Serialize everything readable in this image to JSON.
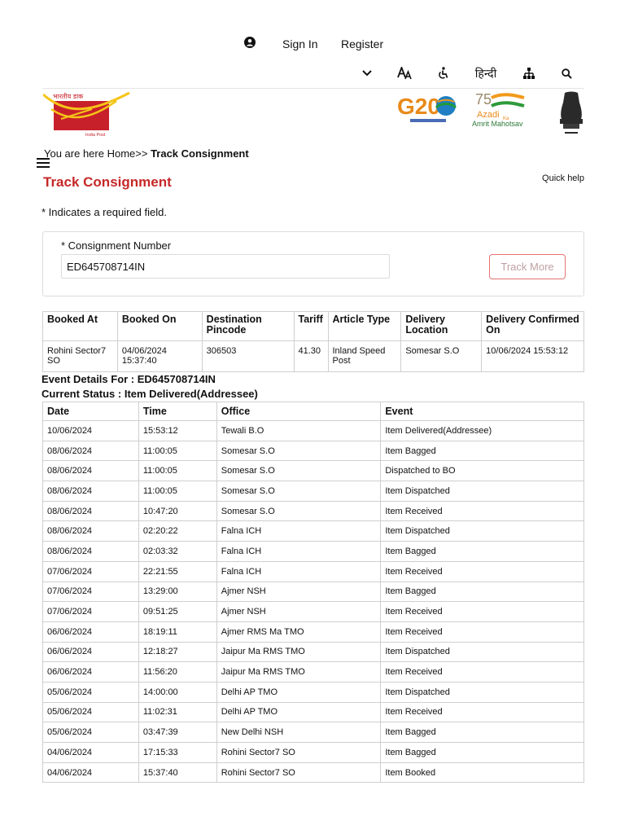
{
  "header": {
    "sign_in": "Sign In",
    "register": "Register",
    "hindi": "हिन्दी",
    "icons": [
      "user-circle-icon",
      "chevron-down-icon",
      "font-size-icon",
      "accessibility-icon",
      "sitemap-icon",
      "search-icon"
    ]
  },
  "logos": {
    "india_post_hindi": "भारतीय डाक",
    "india_post_english": "India Post",
    "g20": "G20",
    "azadi_line1": "Azadi",
    "azadi_ka": "Ka",
    "azadi_line2": "Amrit Mahotsav"
  },
  "breadcrumb": {
    "prefix": "You are here Home>> ",
    "current": "Track Consignment"
  },
  "page": {
    "title": "Track Consignment",
    "quick_help": "Quick help",
    "required_note": "* Indicates a required field."
  },
  "form": {
    "label": "* Consignment Number",
    "value": "ED645708714IN",
    "track_more": "Track More"
  },
  "summary": {
    "headers": [
      "Booked At",
      "Booked On",
      "Destination Pincode",
      "Tariff",
      "Article Type",
      "Delivery Location",
      "Delivery Confirmed On"
    ],
    "row": [
      "Rohini Sector7 SO",
      "04/06/2024 15:37:40",
      "306503",
      "41.30",
      "Inland Speed Post",
      "Somesar S.O",
      "10/06/2024 15:53:12"
    ]
  },
  "event_for": "Event Details For : ED645708714IN",
  "current_status": "Current Status : Item Delivered(Addressee)",
  "events": {
    "headers": [
      "Date",
      "Time",
      "Office",
      "Event"
    ],
    "rows": [
      [
        "10/06/2024",
        "15:53:12",
        "Tewali B.O",
        "Item Delivered(Addressee)"
      ],
      [
        "08/06/2024",
        "11:00:05",
        "Somesar S.O",
        "Item Bagged"
      ],
      [
        "08/06/2024",
        "11:00:05",
        "Somesar S.O",
        "Dispatched to BO"
      ],
      [
        "08/06/2024",
        "11:00:05",
        "Somesar S.O",
        "Item Dispatched"
      ],
      [
        "08/06/2024",
        "10:47:20",
        "Somesar S.O",
        "Item Received"
      ],
      [
        "08/06/2024",
        "02:20:22",
        "Falna ICH",
        "Item Dispatched"
      ],
      [
        "08/06/2024",
        "02:03:32",
        "Falna ICH",
        "Item Bagged"
      ],
      [
        "07/06/2024",
        "22:21:55",
        "Falna ICH",
        "Item Received"
      ],
      [
        "07/06/2024",
        "13:29:00",
        "Ajmer NSH",
        "Item Bagged"
      ],
      [
        "07/06/2024",
        "09:51:25",
        "Ajmer NSH",
        "Item Received"
      ],
      [
        "06/06/2024",
        "18:19:11",
        "Ajmer RMS Ma TMO",
        "Item Received"
      ],
      [
        "06/06/2024",
        "12:18:27",
        "Jaipur Ma RMS TMO",
        "Item Dispatched"
      ],
      [
        "06/06/2024",
        "11:56:20",
        "Jaipur Ma RMS TMO",
        "Item Received"
      ],
      [
        "05/06/2024",
        "14:00:00",
        "Delhi AP TMO",
        "Item Dispatched"
      ],
      [
        "05/06/2024",
        "11:02:31",
        "Delhi AP TMO",
        "Item Received"
      ],
      [
        "05/06/2024",
        "03:47:39",
        "New Delhi NSH",
        "Item Bagged"
      ],
      [
        "04/06/2024",
        "17:15:33",
        "Rohini Sector7 SO",
        "Item Bagged"
      ],
      [
        "04/06/2024",
        "15:37:40",
        "Rohini Sector7 SO",
        "Item Booked"
      ]
    ]
  },
  "colors": {
    "accent_red": "#c62828",
    "post_red": "#c8202a",
    "post_yellow": "#f5c518",
    "border": "#cfcfcf"
  }
}
